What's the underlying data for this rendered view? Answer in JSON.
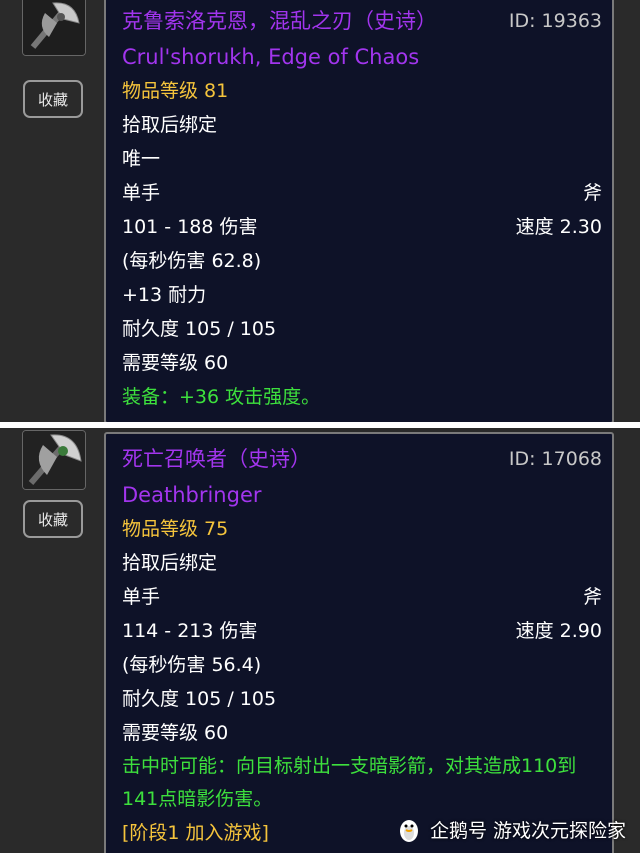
{
  "colors": {
    "epic": "#a235ee",
    "gold": "#f5c43c",
    "green": "#3de03d",
    "tooltip_bg": "#0e1228"
  },
  "items": [
    {
      "icon": "axe-weapon-icon",
      "fav_label": "收藏",
      "name_cn": "克鲁索洛克恩，混乱之刃（史诗）",
      "id_text": "ID: 19363",
      "name_en": "Crul'shorukh, Edge of Chaos",
      "item_level": "物品等级 81",
      "bind": "拾取后绑定",
      "unique": "唯一",
      "slot": "单手",
      "weapon_type": "斧",
      "damage": "101 - 188 伤害",
      "speed": "速度 2.30",
      "dps": "(每秒伤害 62.8)",
      "stat": "+13 耐力",
      "durability": "耐久度 105 / 105",
      "required_level": "需要等级 60",
      "equip_effect": "装备：+36 攻击强度。"
    },
    {
      "icon": "axe-weapon-icon",
      "fav_label": "收藏",
      "name_cn": "死亡召唤者（史诗）",
      "id_text": "ID: 17068",
      "name_en": "Deathbringer",
      "item_level": "物品等级 75",
      "bind": "拾取后绑定",
      "slot": "单手",
      "weapon_type": "斧",
      "damage": "114 - 213 伤害",
      "speed": "速度 2.90",
      "dps": "(每秒伤害 56.4)",
      "durability": "耐久度 105 / 105",
      "required_level": "需要等级 60",
      "proc_effect": "击中时可能：向目标射出一支暗影箭，对其造成110到141点暗影伤害。",
      "phase": "[阶段1 加入游戏]"
    }
  ],
  "watermark": {
    "text": "企鹅号 游戏次元探险家",
    "logo": "penguin-logo-icon"
  }
}
